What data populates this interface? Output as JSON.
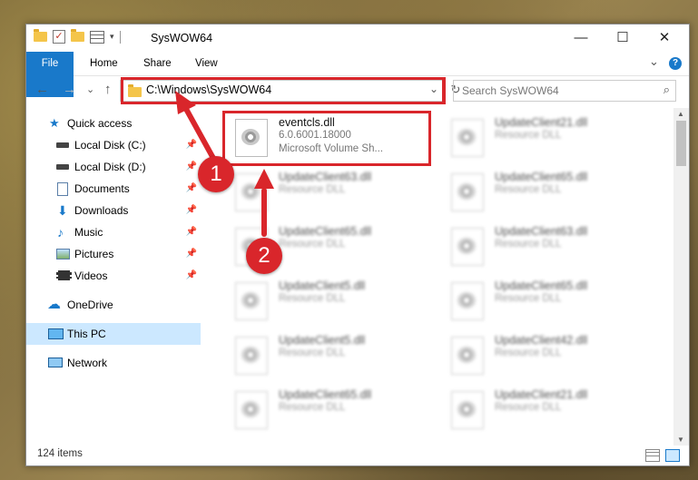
{
  "window": {
    "title": "SysWOW64",
    "minimize": "—",
    "maximize": "☐",
    "close": "✕"
  },
  "ribbon": {
    "tabs": [
      "File",
      "Home",
      "Share",
      "View"
    ],
    "collapse": "⌄",
    "help": "?"
  },
  "address": {
    "path": "C:\\Windows\\SysWOW64",
    "back": "←",
    "forward": "→",
    "recent": "⌄",
    "up": "↑",
    "dropdown": "⌄",
    "refresh": "↻"
  },
  "search": {
    "placeholder": "Search SysWOW64",
    "icon": "⌕"
  },
  "nav": [
    {
      "label": "Quick access",
      "icon": "star-icon",
      "pinned": false
    },
    {
      "label": "Local Disk (C:)",
      "icon": "drive-icon",
      "pinned": true
    },
    {
      "label": "Local Disk (D:)",
      "icon": "drive-icon",
      "pinned": true
    },
    {
      "label": "Documents",
      "icon": "documents-icon",
      "pinned": true
    },
    {
      "label": "Downloads",
      "icon": "download-icon",
      "pinned": true
    },
    {
      "label": "Music",
      "icon": "music-icon",
      "pinned": true
    },
    {
      "label": "Pictures",
      "icon": "pictures-icon",
      "pinned": true
    },
    {
      "label": "Videos",
      "icon": "videos-icon",
      "pinned": true
    },
    {
      "label": "OneDrive",
      "icon": "cloud-icon",
      "pinned": false
    },
    {
      "label": "This PC",
      "icon": "computer-icon",
      "pinned": false,
      "selected": true
    },
    {
      "label": "Network",
      "icon": "network-icon",
      "pinned": false
    }
  ],
  "files": [
    {
      "name": "eventcls.dll",
      "version": "6.0.6001.18000",
      "desc": "Microsoft Volume Sh..."
    },
    {
      "name": "UpdateClient21.dll",
      "desc": "Resource DLL"
    },
    {
      "name": "UpdateClient63.dll",
      "desc": "Resource DLL"
    },
    {
      "name": "UpdateClient65.dll",
      "desc": "Resource DLL"
    },
    {
      "name": "UpdateClient65.dll",
      "desc": "Resource DLL"
    },
    {
      "name": "UpdateClient63.dll",
      "desc": "Resource DLL"
    },
    {
      "name": "UpdateClient5.dll",
      "desc": "Resource DLL"
    },
    {
      "name": "UpdateClient65.dll",
      "desc": "Resource DLL"
    },
    {
      "name": "UpdateClient5.dll",
      "desc": "Resource DLL"
    },
    {
      "name": "UpdateClient42.dll",
      "desc": "Resource DLL"
    },
    {
      "name": "UpdateClient65.dll",
      "desc": "Resource DLL"
    },
    {
      "name": "UpdateClient21.dll",
      "desc": "Resource DLL"
    }
  ],
  "status": {
    "count": "124 items"
  },
  "annotations": [
    {
      "number": "1"
    },
    {
      "number": "2"
    }
  ],
  "colors": {
    "accent": "#1979ca",
    "highlight": "#d9262b",
    "selection": "#cce8ff"
  }
}
